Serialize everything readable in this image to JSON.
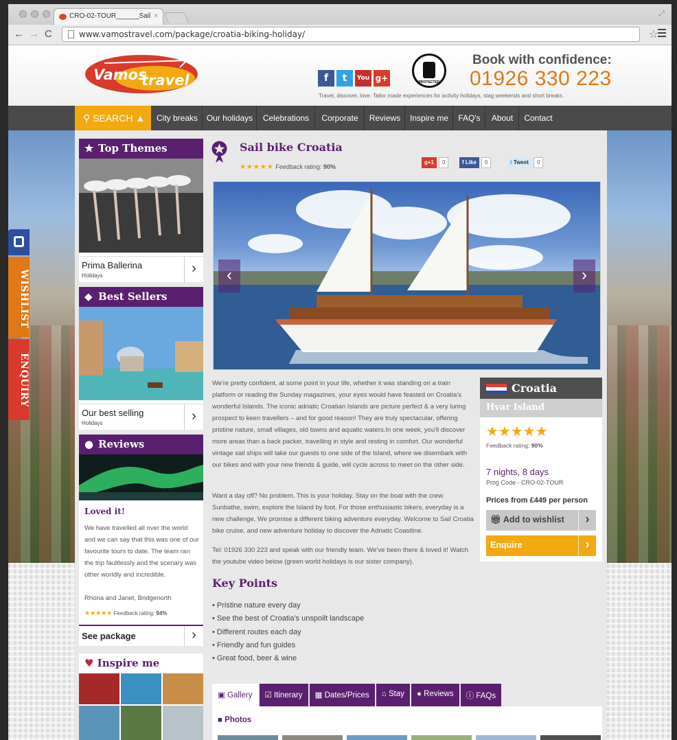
{
  "browser": {
    "tab_title": "CRO-02-TOUR______Sail",
    "url": "www.vamostravel.com/package/croatia-biking-holiday/"
  },
  "header": {
    "logo_text_1": "Vamos",
    "logo_text_2": "travel",
    "book_title": "Book with confidence:",
    "phone": "01926 330 223",
    "tagline": "Travel, discover, love. Tailor made experiences for activity holidays, stag weekends and short breaks.",
    "badge_text": "PROTECTED"
  },
  "nav": {
    "search": "SEARCH",
    "items": [
      "City breaks",
      "Our holidays",
      "Celebrations",
      "Corporate",
      "Reviews",
      "Inspire me",
      "FAQ's",
      "About",
      "Contact"
    ]
  },
  "side_tabs": {
    "wishlist": "WISHLIST",
    "enquiry": "ENQUIRY"
  },
  "sidebar": {
    "top_themes": {
      "title": "Top Themes",
      "item": "Prima Ballerina",
      "sub": "Holidays"
    },
    "best_sellers": {
      "title": "Best Sellers",
      "item": "Our best selling",
      "sub": "Holidays"
    },
    "reviews": {
      "title": "Reviews",
      "heading": "Loved it!",
      "text": "We have travelled all over the world and we can say that this was one of our favourite tours to date. The team ran the trip faultlessly and the scenary was other worldly and incredible.",
      "author": "Rhona and Janet, Bridgenorth",
      "feedback_label": "Feedback rating:",
      "feedback_value": "94%",
      "rating_stars": 5,
      "see_package": "See package"
    },
    "inspire": {
      "title": "Inspire me"
    }
  },
  "package": {
    "title": "Sail bike Croatia",
    "feedback_label": "Feedback rating:",
    "feedback_value": "90%",
    "rating_stars": 5,
    "share": {
      "gplus_label": "g+1",
      "gplus_count": "0",
      "fb_label": "Like",
      "fb_count": "0",
      "tw_label": "Tweet",
      "tw_count": "0"
    },
    "paragraph_1": "We're pretty confident, at some point in your life, whether it was standing on a train platform or reading the Sunday magazines, your eyes would have feasted on Croatia's wonderful Islands. The iconic adriatic Croatian Islands are picture perfect & a very luring prospect to keen travellers – and for good reason! They are truly spectacular, offering pristine nature, small villages, old towns and aquatic waters.In one week, you'll discover more areas than a back packer, travelling in style and resting in comfort. Our wonderful vintage sail ships will take our guests to one side of the Island, where we disembark with our bikes and with your new friends & guide, will cycle across to meet on the other side.",
    "paragraph_2": "Want a day off? No problem. This is your holiday. Stay on the boat with the crew. Sunbathe, swim, explore the Island by foot. For those enthusiastic bikers, everyday is a new challenge. We promise a different biking adventure everyday. Welcome to Sail Croatia bike cruise, and new adventure holiday to discover the Adriatic Coastline.",
    "paragraph_3": "Tel: 01926 330 223 and speak with our friendly team. We've been there & loved it! Watch the youtube video below (green world holidays is our sister company).",
    "key_points_title": "Key Points",
    "key_points": [
      "Pristine nature every day",
      "See the best of Croatia's unspoilt landscape",
      "Different routes each day",
      "Friendly and fun guides",
      "Great food, beer & wine"
    ],
    "tabs": [
      "Gallery",
      "Itinerary",
      "Dates/Prices",
      "Stay",
      "Reviews",
      "FAQs"
    ],
    "photos_label": "Photos"
  },
  "info_box": {
    "country": "Croatia",
    "region": "Hvar Island",
    "rating_stars": 5,
    "feedback_label": "Feedback rating:",
    "feedback_value": "90%",
    "duration": "7 nights, 8 days",
    "prog_code": "Prog Code - CRO-02-TOUR",
    "price": "Prices from £449 per person",
    "wishlist_btn": "Add to wishlist",
    "enquire_btn": "Enquire"
  },
  "colors": {
    "purple": "#5a1f6f",
    "orange": "#f4a811",
    "nav_bg": "#4a4a4a",
    "wishlist_tab": "#e07818",
    "enquiry_tab": "#d93a2b"
  },
  "icons": [
    "star-icon",
    "tag-icon",
    "speech-bubble-icon",
    "heart-icon",
    "chevron-right-icon",
    "search-icon",
    "camera-icon",
    "gift-icon",
    "home-icon",
    "info-icon",
    "calendar-icon",
    "checklist-icon",
    "picture-icon",
    "video-icon"
  ]
}
